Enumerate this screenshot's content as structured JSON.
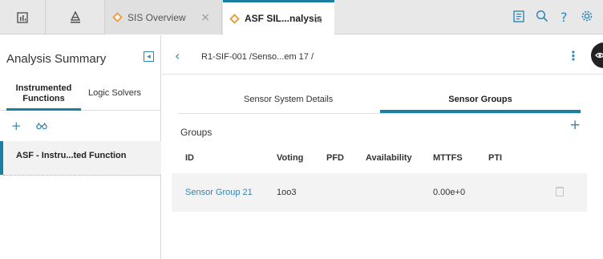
{
  "topbar": {
    "icons": [
      "dashboard-icon",
      "hierarchy-icon"
    ],
    "tabs": [
      {
        "label": "SIS Overview",
        "close": "×"
      },
      {
        "label": "ASF SIL...nalysis",
        "close": "×"
      }
    ],
    "right_icons": [
      "clipboard-icon",
      "search-icon",
      "help-icon",
      "gear-icon"
    ],
    "help_glyph": "?"
  },
  "left_panel": {
    "title": "Analysis Summary",
    "collapse_glyph": "◂",
    "subtabs": [
      "Instrumented Functions",
      "Logic Solvers"
    ],
    "tools": [
      "+",
      "⌕⌕"
    ],
    "items": [
      {
        "label": "ASF - Instru...ted Function"
      }
    ]
  },
  "main": {
    "breadcrumb": "R1-SIF-001 /Senso...em 17 /",
    "back_glyph": "‹",
    "kebab_glyph": "⋮",
    "tabs": [
      "Sensor System Details",
      "Sensor Groups"
    ],
    "section_title": "Groups",
    "add_glyph": "+",
    "table": {
      "headers": [
        "ID",
        "Voting",
        "PFD",
        "Availability",
        "MTTFS",
        "PTI"
      ],
      "rows": [
        {
          "id": "Sensor Group 21",
          "voting": "1oo3",
          "pfd": "",
          "availability": "",
          "mttfs": "0.00e+0",
          "pti": ""
        }
      ]
    }
  },
  "colors": {
    "accent": "#1a7fa0",
    "link": "#2e87b4",
    "tab_diamond": "#f0a030"
  }
}
